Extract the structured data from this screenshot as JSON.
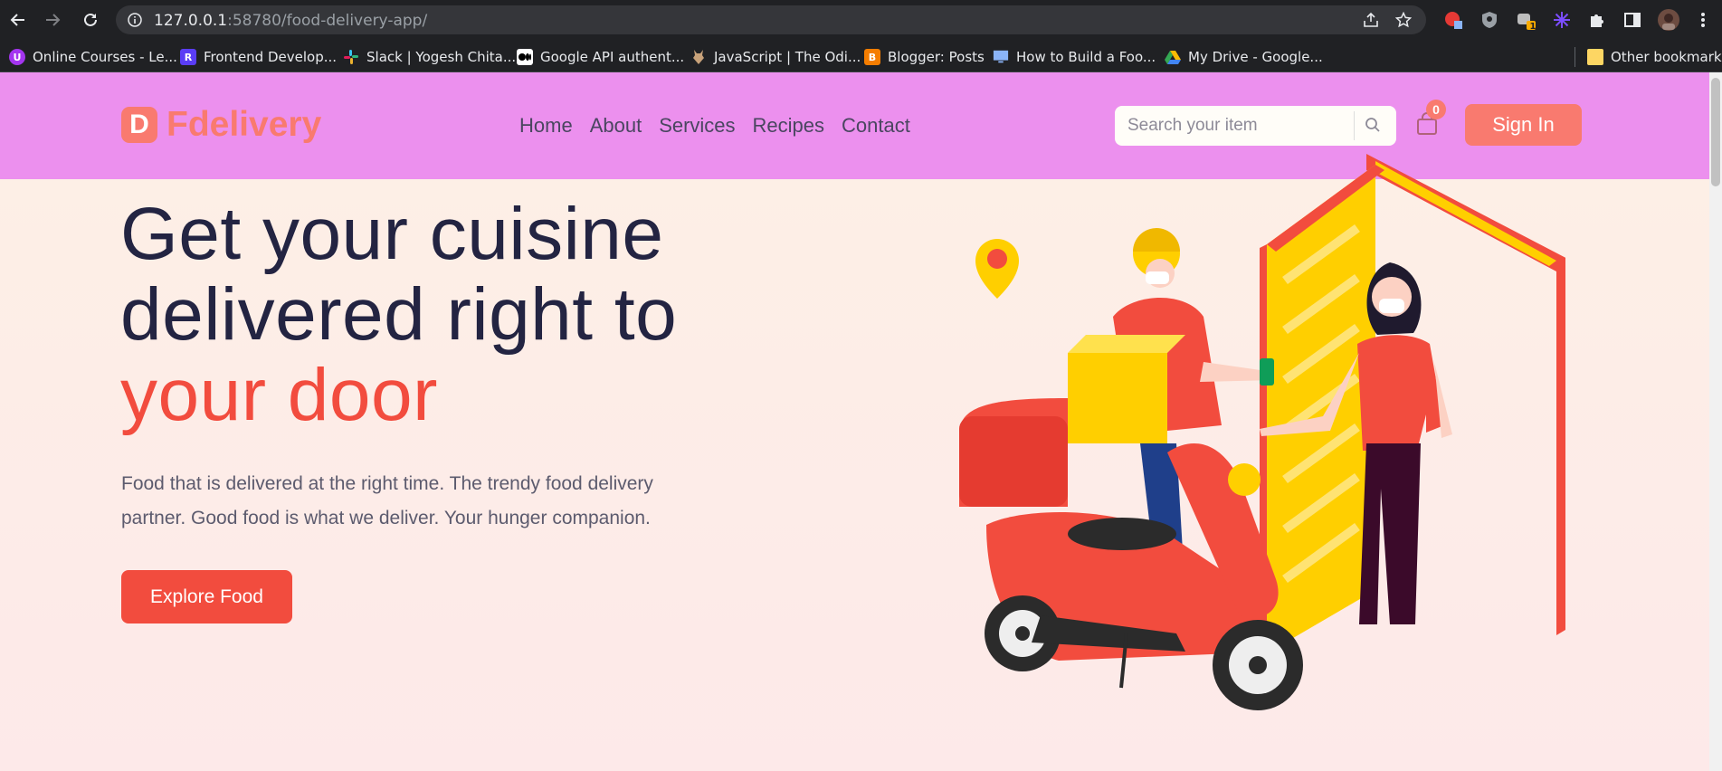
{
  "browser": {
    "url_host": "127.0.0.1",
    "url_rest": ":58780/food-delivery-app/",
    "extension_badge": "1",
    "bookmarks": [
      {
        "label": "Online Courses - Le...",
        "color": "#a435f0",
        "glyph": "U"
      },
      {
        "label": "Frontend Develop...",
        "color": "#5a3df5",
        "glyph": "R"
      },
      {
        "label": "Slack | Yogesh Chita...",
        "color": "#e01e5a",
        "glyph": ""
      },
      {
        "label": "Google API authent...",
        "color": "#000000",
        "glyph": ""
      },
      {
        "label": "JavaScript | The Odi...",
        "color": "#c8a27a",
        "glyph": ""
      },
      {
        "label": "Blogger: Posts",
        "color": "#f57d00",
        "glyph": "B"
      },
      {
        "label": "How to Build a Foo...",
        "color": "#1a73e8",
        "glyph": ""
      },
      {
        "label": "My Drive - Google...",
        "color": "#34a853",
        "glyph": ""
      }
    ],
    "other_bookmarks": "Other bookmarks"
  },
  "site": {
    "logo_letter": "D",
    "logo_text": "Fdelivery",
    "nav": [
      "Home",
      "About",
      "Services",
      "Recipes",
      "Contact"
    ],
    "search_placeholder": "Search your item",
    "cart_count": "0",
    "signin_label": "Sign In"
  },
  "hero": {
    "line1": "Get your cuisine",
    "line2": "delivered right to",
    "line3": "your door",
    "description": "Food that is delivered at the right time. The trendy food delivery partner. Good food is what we deliver. Your hunger companion.",
    "cta_label": "Explore Food"
  },
  "colors": {
    "header_bg": "#ec90ee",
    "accent": "#f97a6f",
    "cta": "#f24c3e",
    "headline": "#232442"
  }
}
